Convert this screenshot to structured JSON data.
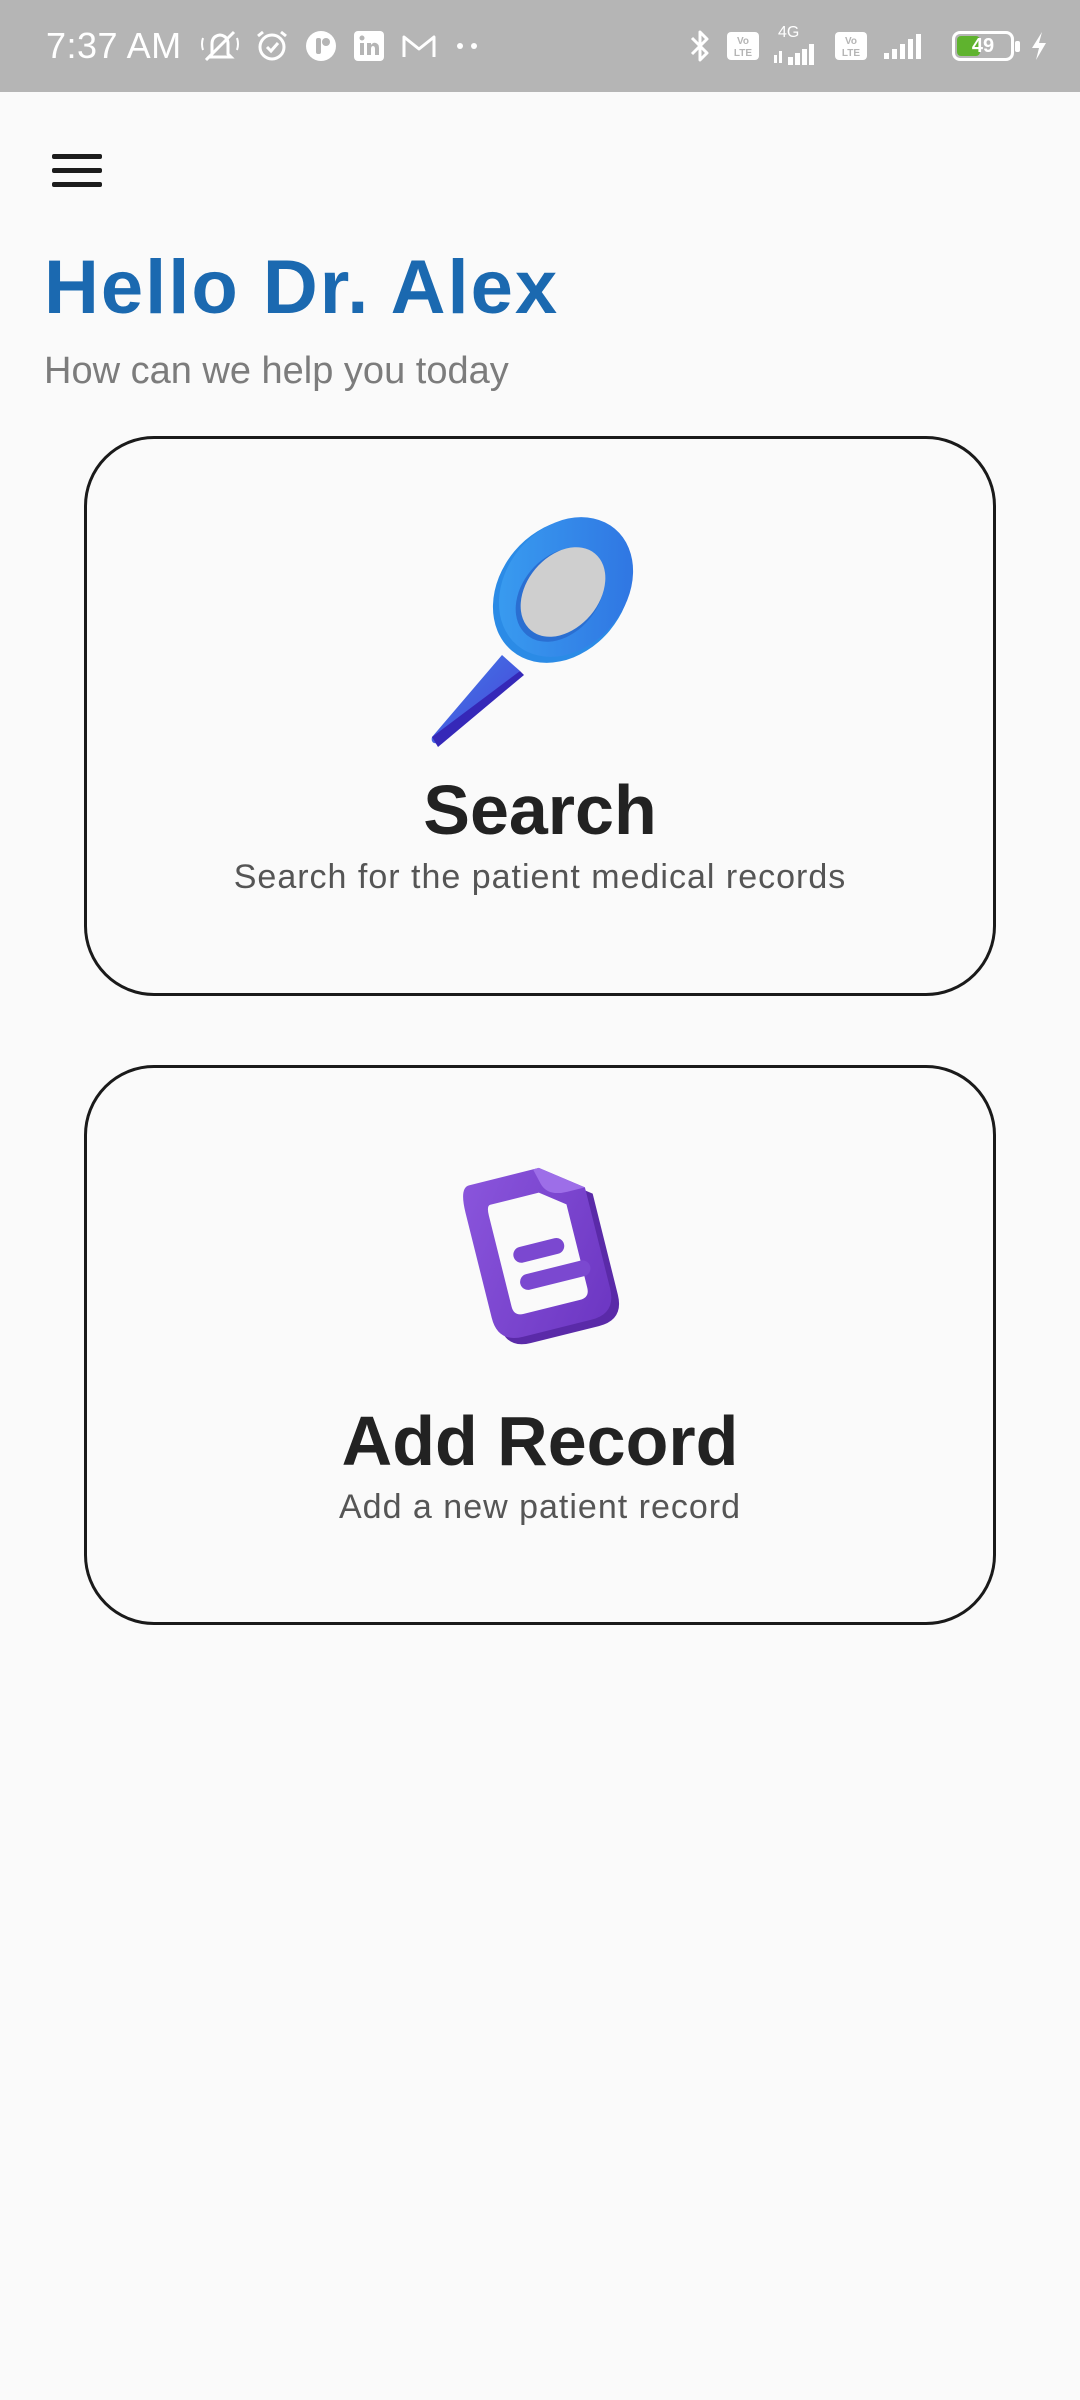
{
  "status_bar": {
    "time": "7:37 AM",
    "network_4g": "4G",
    "volte_1": "Vo LTE",
    "volte_2": "Vo LTE",
    "battery_level": 49,
    "battery_text": "49",
    "left_icons": [
      "mute-icon",
      "alarm-icon",
      "app-icon",
      "linkedin-icon",
      "gmail-icon",
      "more-dots-icon"
    ],
    "right_icons": [
      "bluetooth-icon",
      "volte-icon",
      "signal-icon",
      "volte-icon",
      "signal-icon",
      "battery-icon",
      "charging-icon"
    ]
  },
  "header": {
    "menu_icon": "hamburger-menu-icon"
  },
  "greeting": {
    "title": "Hello Dr. Alex",
    "subtitle": "How can we help you today"
  },
  "cards": [
    {
      "title": "Search",
      "description": "Search for the patient medical records",
      "icon": "magnifier-icon"
    },
    {
      "title": "Add Record",
      "description": "Add a new patient record",
      "icon": "record-tag-icon"
    }
  ],
  "colors": {
    "accent": "#1b69b0",
    "status_bar": "#b5b5b5",
    "background": "#fafafa",
    "search_icon": "#3a8be8",
    "record_icon": "#7b48d0",
    "battery": "#5fb32e"
  }
}
